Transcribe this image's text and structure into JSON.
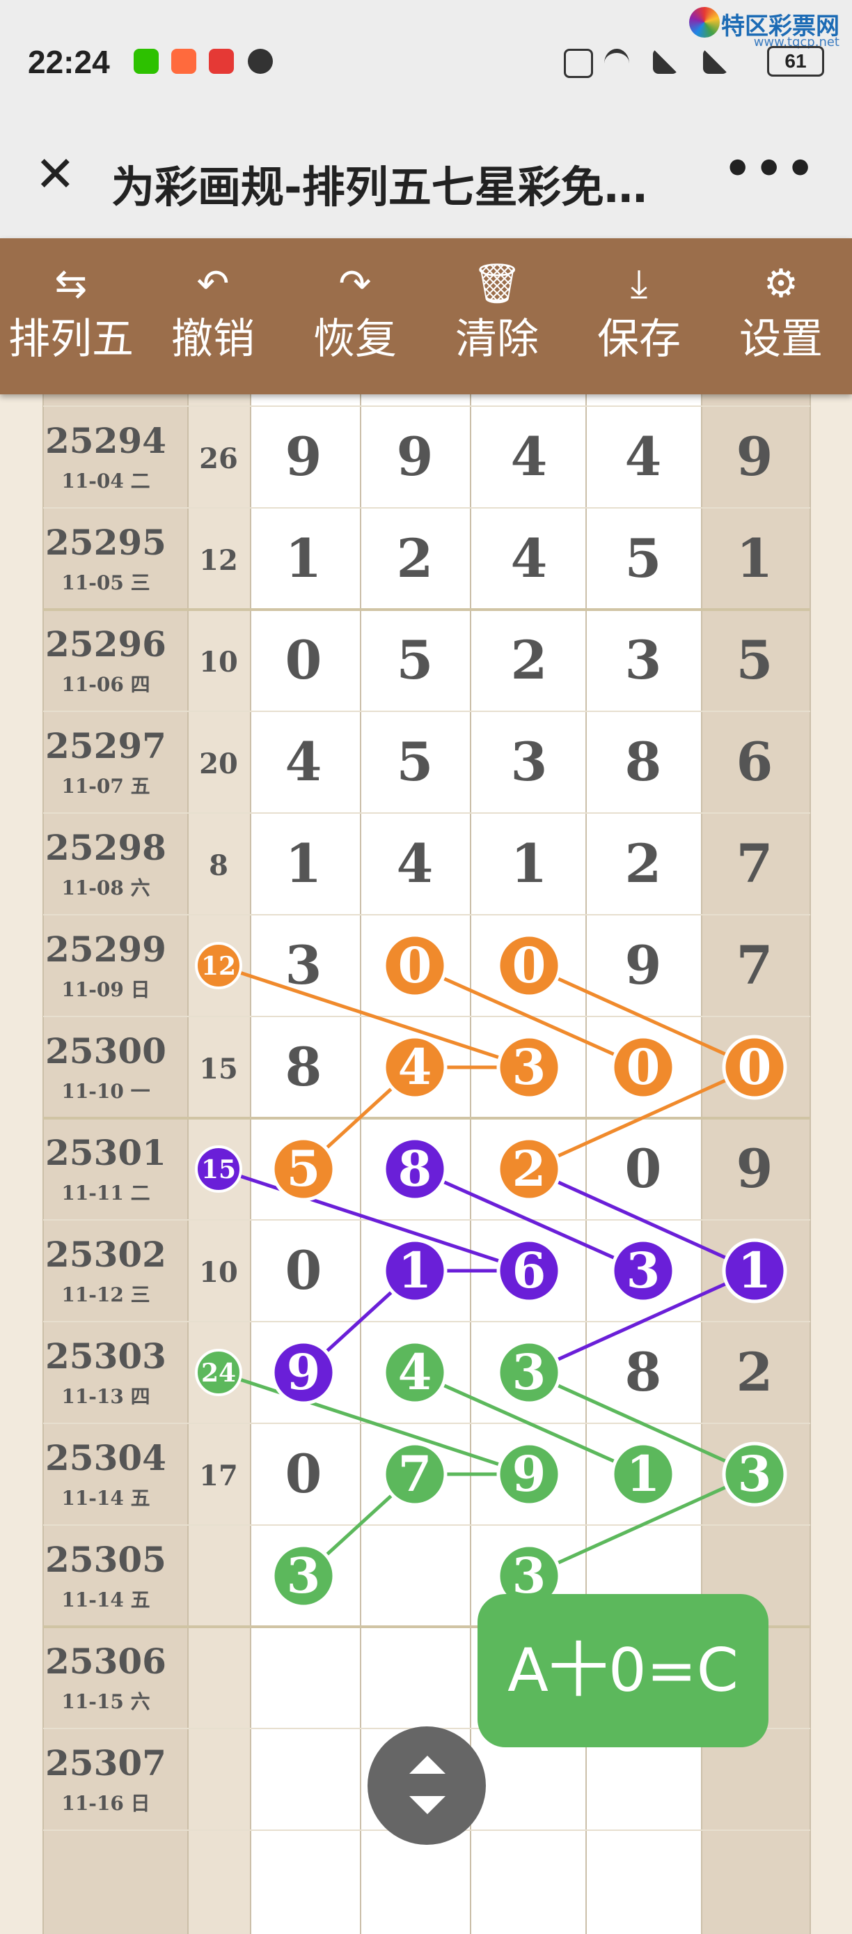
{
  "status_bar": {
    "time": "22:24",
    "battery": "61"
  },
  "watermark": {
    "name": "特区彩票网",
    "url": "www.tqcp.net"
  },
  "title_bar": {
    "title": "为彩画规-排列五七星彩免…"
  },
  "toolbar": [
    {
      "icon": "swap-icon",
      "glyph": "⇆",
      "label": "排列五"
    },
    {
      "icon": "undo-icon",
      "glyph": "↶",
      "label": "撤销"
    },
    {
      "icon": "redo-icon",
      "glyph": "↷",
      "label": "恢复"
    },
    {
      "icon": "trash-icon",
      "glyph": "🗑",
      "label": "清除"
    },
    {
      "icon": "download-icon",
      "glyph": "⤓",
      "label": "保存"
    },
    {
      "icon": "gear-icon",
      "glyph": "⚙",
      "label": "设置"
    }
  ],
  "colors": {
    "orange": "#f08a2c",
    "purple": "#6a1fd8",
    "green": "#5cb85c",
    "toolbar": "#9b6e4b"
  },
  "rows": [
    {
      "issue": "25294",
      "date": "11-04 二",
      "sum": "26",
      "digits": [
        "9",
        "9",
        "4",
        "4",
        "9"
      ]
    },
    {
      "issue": "25295",
      "date": "11-05 三",
      "sum": "12",
      "digits": [
        "1",
        "2",
        "4",
        "5",
        "1"
      ]
    },
    {
      "issue": "25296",
      "date": "11-06 四",
      "sum": "10",
      "digits": [
        "0",
        "5",
        "2",
        "3",
        "5"
      ]
    },
    {
      "issue": "25297",
      "date": "11-07 五",
      "sum": "20",
      "digits": [
        "4",
        "5",
        "3",
        "8",
        "6"
      ]
    },
    {
      "issue": "25298",
      "date": "11-08 六",
      "sum": "8",
      "digits": [
        "1",
        "4",
        "1",
        "2",
        "7"
      ]
    },
    {
      "issue": "25299",
      "date": "11-09 日",
      "sum": "",
      "digits": [
        "3",
        "0",
        "0",
        "9",
        "7"
      ]
    },
    {
      "issue": "25300",
      "date": "11-10 一",
      "sum": "15",
      "digits": [
        "8",
        "4",
        "3",
        "0",
        "0"
      ]
    },
    {
      "issue": "25301",
      "date": "11-11 二",
      "sum": "",
      "digits": [
        "5",
        "8",
        "2",
        "0",
        "9"
      ]
    },
    {
      "issue": "25302",
      "date": "11-12 三",
      "sum": "10",
      "digits": [
        "0",
        "1",
        "6",
        "3",
        "1"
      ]
    },
    {
      "issue": "25303",
      "date": "11-13 四",
      "sum": "",
      "digits": [
        "9",
        "4",
        "3",
        "8",
        "2"
      ]
    },
    {
      "issue": "25304",
      "date": "11-14 五",
      "sum": "17",
      "digits": [
        "0",
        "7",
        "9",
        "1",
        "3"
      ]
    },
    {
      "issue": "25305",
      "date": "11-14 五",
      "sum": "",
      "digits": [
        "3",
        "",
        "3",
        "",
        ""
      ]
    },
    {
      "issue": "25306",
      "date": "11-15 六",
      "sum": "",
      "digits": [
        "",
        "",
        "",
        "",
        ""
      ]
    },
    {
      "issue": "25307",
      "date": "11-16 日",
      "sum": "",
      "digits": [
        "",
        "",
        "",
        "",
        ""
      ]
    }
  ],
  "markers": [
    {
      "color": "orange",
      "row": 5,
      "col": "sum",
      "label": "12"
    },
    {
      "color": "purple",
      "row": 7,
      "col": "sum",
      "label": "15"
    },
    {
      "color": "green",
      "row": 9,
      "col": "sum",
      "label": "24"
    }
  ],
  "circles": [
    {
      "color": "orange",
      "row": 5,
      "col": 1
    },
    {
      "color": "orange",
      "row": 5,
      "col": 2
    },
    {
      "color": "orange",
      "row": 6,
      "col": 1
    },
    {
      "color": "orange",
      "row": 6,
      "col": 2
    },
    {
      "color": "orange",
      "row": 6,
      "col": 3
    },
    {
      "color": "orange",
      "row": 6,
      "col": 4
    },
    {
      "color": "orange",
      "row": 7,
      "col": 0
    },
    {
      "color": "purple",
      "row": 7,
      "col": 1
    },
    {
      "color": "orange",
      "row": 7,
      "col": 2
    },
    {
      "color": "purple",
      "row": 8,
      "col": 1
    },
    {
      "color": "purple",
      "row": 8,
      "col": 2
    },
    {
      "color": "purple",
      "row": 8,
      "col": 3
    },
    {
      "color": "purple",
      "row": 8,
      "col": 4
    },
    {
      "color": "purple",
      "row": 9,
      "col": 0
    },
    {
      "color": "green",
      "row": 9,
      "col": 1
    },
    {
      "color": "green",
      "row": 9,
      "col": 2
    },
    {
      "color": "green",
      "row": 10,
      "col": 1
    },
    {
      "color": "green",
      "row": 10,
      "col": 2
    },
    {
      "color": "green",
      "row": 10,
      "col": 3
    },
    {
      "color": "green",
      "row": 10,
      "col": 4
    },
    {
      "color": "green",
      "row": 11,
      "col": 0
    },
    {
      "color": "green",
      "row": 11,
      "col": 2
    }
  ],
  "lines": [
    {
      "color": "orange",
      "from": [
        5,
        "sum"
      ],
      "to": [
        6,
        2
      ]
    },
    {
      "color": "orange",
      "from": [
        5,
        1
      ],
      "to": [
        6,
        3
      ]
    },
    {
      "color": "orange",
      "from": [
        5,
        2
      ],
      "to": [
        6,
        4
      ]
    },
    {
      "color": "orange",
      "from": [
        6,
        1
      ],
      "to": [
        6,
        2
      ]
    },
    {
      "color": "orange",
      "from": [
        6,
        1
      ],
      "to": [
        7,
        0
      ]
    },
    {
      "color": "orange",
      "from": [
        6,
        4
      ],
      "to": [
        7,
        2
      ]
    },
    {
      "color": "purple",
      "from": [
        7,
        "sum"
      ],
      "to": [
        8,
        2
      ]
    },
    {
      "color": "purple",
      "from": [
        7,
        1
      ],
      "to": [
        8,
        3
      ]
    },
    {
      "color": "purple",
      "from": [
        7,
        2
      ],
      "to": [
        8,
        4
      ]
    },
    {
      "color": "purple",
      "from": [
        8,
        1
      ],
      "to": [
        8,
        2
      ]
    },
    {
      "color": "purple",
      "from": [
        8,
        1
      ],
      "to": [
        9,
        0
      ]
    },
    {
      "color": "purple",
      "from": [
        8,
        4
      ],
      "to": [
        9,
        2
      ]
    },
    {
      "color": "green",
      "from": [
        9,
        "sum"
      ],
      "to": [
        10,
        2
      ]
    },
    {
      "color": "green",
      "from": [
        9,
        1
      ],
      "to": [
        10,
        3
      ]
    },
    {
      "color": "green",
      "from": [
        9,
        2
      ],
      "to": [
        10,
        4
      ]
    },
    {
      "color": "green",
      "from": [
        10,
        1
      ],
      "to": [
        10,
        2
      ]
    },
    {
      "color": "green",
      "from": [
        10,
        1
      ],
      "to": [
        11,
        0
      ]
    },
    {
      "color": "green",
      "from": [
        10,
        4
      ],
      "to": [
        11,
        2
      ]
    }
  ],
  "fab": {
    "label": "A十0=C"
  }
}
